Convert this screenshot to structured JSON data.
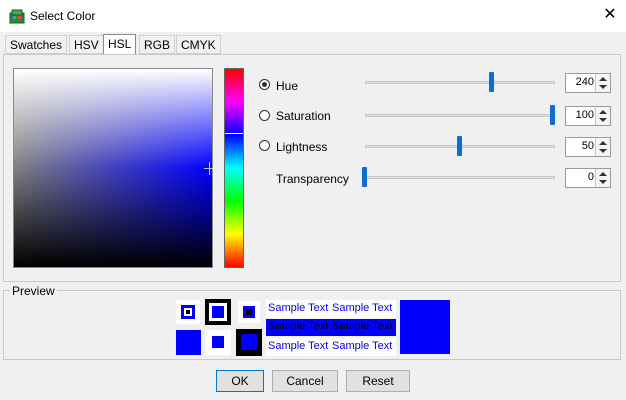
{
  "window": {
    "title": "Select Color",
    "close_glyph": "✕"
  },
  "tabs": [
    {
      "label": "Swatches",
      "selected": false
    },
    {
      "label": "HSV",
      "selected": false
    },
    {
      "label": "HSL",
      "selected": true
    },
    {
      "label": "RGB",
      "selected": false
    },
    {
      "label": "CMYK",
      "selected": false
    }
  ],
  "controls": {
    "hue": {
      "label": "Hue",
      "value": "240",
      "selected": true
    },
    "saturation": {
      "label": "Saturation",
      "value": "100",
      "selected": false
    },
    "lightness": {
      "label": "Lightness",
      "value": "50",
      "selected": false
    },
    "transparency": {
      "label": "Transparency",
      "value": "0"
    }
  },
  "preview": {
    "label": "Preview",
    "sample_text": "Sample Text",
    "color": "#0000ff"
  },
  "buttons": {
    "ok": "OK",
    "cancel": "Cancel",
    "reset": "Reset"
  },
  "icons": {
    "app": "color-palette-icon",
    "close": "close-icon"
  }
}
